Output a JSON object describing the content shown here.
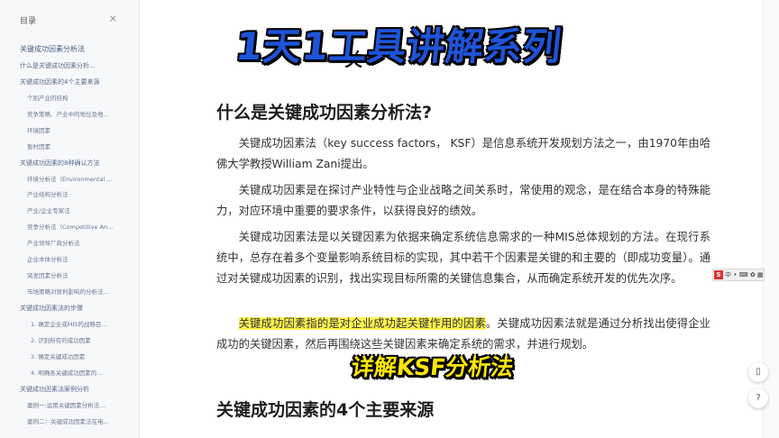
{
  "sidebar": {
    "title": "目录",
    "close": "×",
    "items": [
      {
        "label": "关键成功因素分析法",
        "level": 0
      },
      {
        "label": "什么是关键成功因素分析...",
        "level": 1
      },
      {
        "label": "关键成功因素的4个主要来源",
        "level": 1
      },
      {
        "label": "个别产业的结构",
        "level": 2
      },
      {
        "label": "竞争策略、产业中的地位及地...",
        "level": 2
      },
      {
        "label": "环境因素",
        "level": 2
      },
      {
        "label": "暂时因素",
        "level": 2
      },
      {
        "label": "关键成功因素的8种确认方法",
        "level": 1
      },
      {
        "label": "环境分析法（Environmental ...",
        "level": 2
      },
      {
        "label": "产业结构分析法",
        "level": 2
      },
      {
        "label": "产业/企业专家法",
        "level": 2
      },
      {
        "label": "竞争分析法（Competitive An...",
        "level": 2
      },
      {
        "label": "产业领导厂商分析法",
        "level": 2
      },
      {
        "label": "企业本体分析法",
        "level": 2
      },
      {
        "label": "突发因素分析法",
        "level": 2
      },
      {
        "label": "市场策略对获利影响的分析法...",
        "level": 2
      },
      {
        "label": "关键成功因素法的步骤",
        "level": 1
      },
      {
        "label": "1. 确定企业或MIS的战略目...",
        "level": 3
      },
      {
        "label": "2. 识别所有的成功因素",
        "level": 3
      },
      {
        "label": "3. 确定关键成功因素",
        "level": 3
      },
      {
        "label": "4. 明确各关键成功因素的...",
        "level": 3
      },
      {
        "label": "关键成功因素法案例分析",
        "level": 1
      },
      {
        "label": "案例一:运用关键因素分析法...",
        "level": 2
      },
      {
        "label": "案例二：关键成功因素法在电...",
        "level": 2
      }
    ]
  },
  "banner": {
    "partial_heading": "关",
    "overlay_title": "1天1工具讲解系列",
    "sticker": "详解KSF分析法"
  },
  "article": {
    "heading_what": "什么是关键成功因素分析法?",
    "p1": "关键成功因素法（key success factors， KSF）是信息系统开发规划方法之一，由1970年由哈佛大学教授William Zani提出。",
    "p2": "关键成功因素是在探讨产业特性与企业战略之间关系时，常使用的观念，是在结合本身的特殊能力，对应环境中重要的要求条件，以获得良好的绩效。",
    "p3": "关键成功因素法是以关键因素为依据来确定系统信息需求的一种MIS总体规划的方法。在现行系统中，总存在着多个变量影响系统目标的实现，其中若干个因素是关键的和主要的（即成功变量）。通过对关键成功因素的识别，找出实现目标所需的关键信息集合，从而确定系统开发的优先次序。",
    "p4_highlight": "关键成功因素指的是对企业成功起关键作用的因素",
    "p4_rest": "。关键成功因素法就是通过分析找出使得企业成功的关键因素，然后再围绕这些关键因素来确定系统的需求，并进行规划。",
    "heading_four": "关键成功因素的4个主要来源"
  },
  "toolbar": {
    "logo": "S",
    "items": "中 • ⌨ ✿ ▦ ♟ ⚙"
  },
  "rail": {
    "phone_icon_label": "▯",
    "help_label": "?"
  }
}
